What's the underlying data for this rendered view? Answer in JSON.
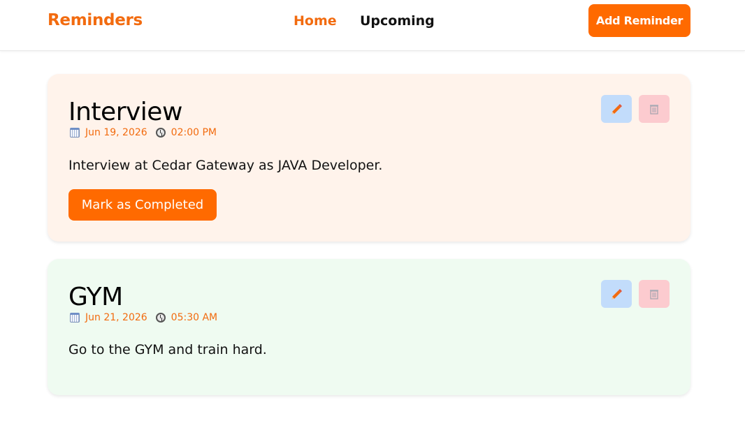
{
  "nav": {
    "brand": "Reminders",
    "links": [
      {
        "label": "Home",
        "active": true
      },
      {
        "label": "Upcoming",
        "active": false
      }
    ],
    "add_button": "Add Reminder"
  },
  "colors": {
    "accent": "#ff6a00",
    "card_pending_bg": "#fff3eb",
    "card_done_bg": "#effbf1",
    "edit_button_bg": "#c2dcfb",
    "delete_button_bg": "#fccbcf"
  },
  "reminders": [
    {
      "title": "Interview",
      "date": "Jun 19, 2026",
      "time": "02:00 PM",
      "description": "Interview at Cedar Gateway as JAVA Developer.",
      "complete_button": "Mark as Completed",
      "icons": {
        "date": "calendar-icon",
        "time": "clock-icon",
        "edit": "pencil-icon",
        "delete": "trash-icon"
      }
    },
    {
      "title": "GYM",
      "date": "Jun 21, 2026",
      "time": "05:30 AM",
      "description": "Go to the GYM and train hard.",
      "icons": {
        "date": "calendar-icon",
        "time": "clock-icon",
        "edit": "pencil-icon",
        "delete": "trash-icon"
      }
    }
  ]
}
